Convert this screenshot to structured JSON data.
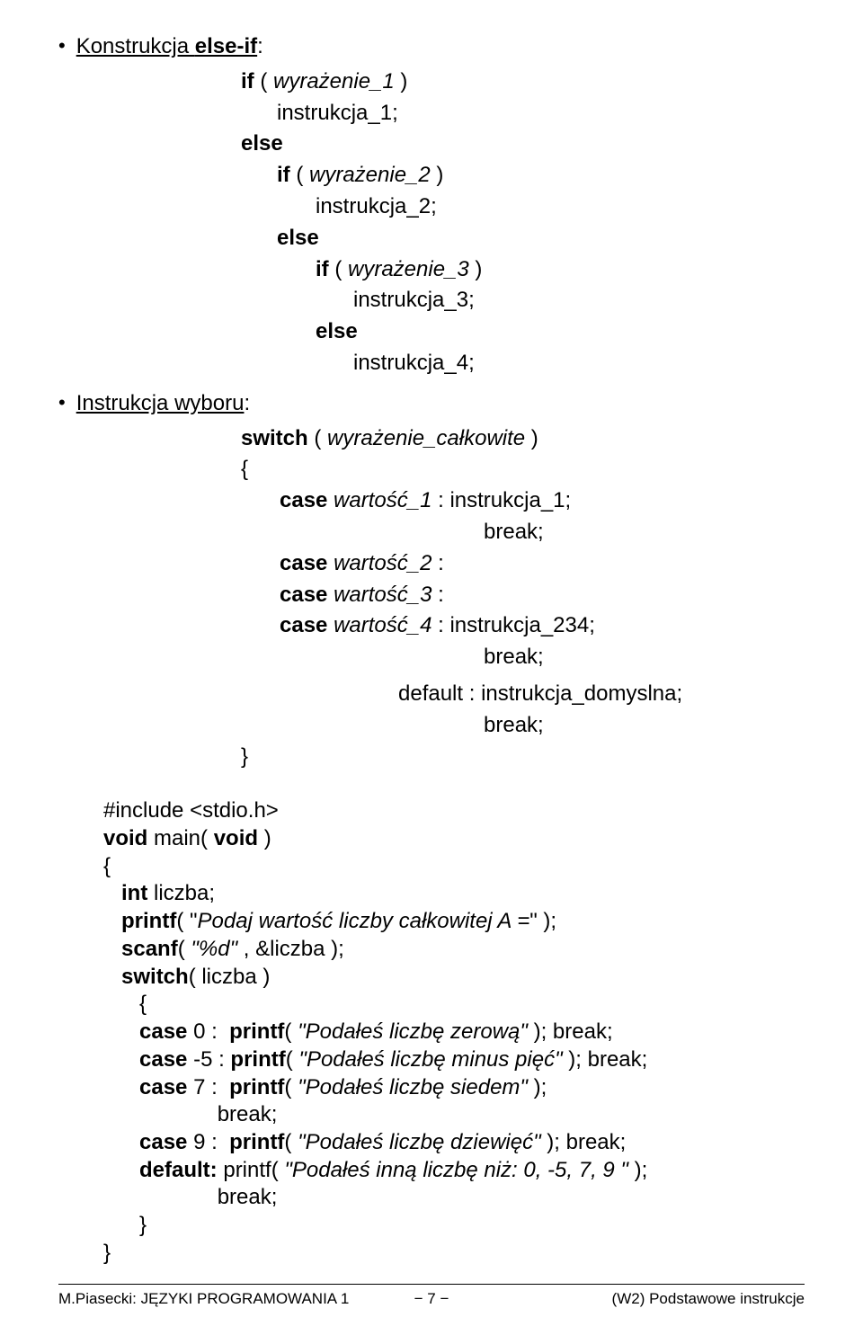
{
  "bullet1": {
    "text_plain": "Konstrukcja  ",
    "text_bold": "else-if",
    "colon": ":"
  },
  "elseif_block": {
    "l1_if": "if",
    "l1_open": " ( ",
    "l1_expr": "wyrażenie_1",
    "l1_close": " )",
    "l2": "instrukcja_1;",
    "l3": "else",
    "l4_if": "if",
    "l4_open": " ( ",
    "l4_expr": "wyrażenie_2",
    "l4_close": " )",
    "l5": "instrukcja_2;",
    "l6": "else",
    "l7_if": "if",
    "l7_open": " ( ",
    "l7_expr": "wyrażenie_3",
    "l7_close": " )",
    "l8": "instrukcja_3;",
    "l9": "else",
    "l10": "instrukcja_4;"
  },
  "bullet2": {
    "text": "Instrukcja wyboru",
    "colon": ":"
  },
  "switch_block": {
    "l1_sw": "switch",
    "l1_open": " ( ",
    "l1_expr": "wyrażenie_całkowite",
    "l1_close": " )",
    "l2": "{",
    "l3_case": "case",
    "l3_v": " wartość_1 ",
    "l3_colon": ":",
    "l3_instr": " instrukcja_1;",
    "l4": "break;",
    "l5_case": "case ",
    "l5_v": "wartość_2 ",
    "l5_colon": ":",
    "l6_case": "case ",
    "l6_v": "wartość_3",
    "l6_after": " :",
    "l7_case": "case ",
    "l7_v": "wartość_4",
    "l7_colon": " :",
    "l7_instr": " instrukcja_234;",
    "l8": "break;",
    "l9_default": "default :  ",
    "l9_instr": "instrukcja_domyslna;",
    "l10": "break;",
    "l11": "}"
  },
  "code": {
    "l1": "#include <stdio.h>",
    "l2a": "void",
    "l2b": " main( ",
    "l2c": "void",
    "l2d": " )",
    "l3": "{",
    "l4a": "   int",
    "l4b": " liczba;",
    "l5a": "   printf",
    "l5b": "( \"",
    "l5c": "Podaj wartość liczby całkowitej A =",
    "l5d": "\" );",
    "l6a": "   scanf",
    "l6b": "( ",
    "l6c": "\"%d\"",
    "l6d": " , &liczba );",
    "l7a": "   switch",
    "l7b": "( liczba )",
    "l8": "      {",
    "l9a": "      case ",
    "l9b": "0 :  ",
    "l9c": "printf",
    "l9d": "( ",
    "l9e": "\"Podałeś liczbę zerową\"",
    "l9f": " ); break;",
    "l10a": "      case ",
    "l10b": "-5 :",
    "l10c": " printf",
    "l10d": "( ",
    "l10e": "\"Podałeś liczbę minus pięć\"",
    "l10f": " ); break;",
    "l11a": "      case ",
    "l11b": "7 :  ",
    "l11c": "printf",
    "l11d": "( ",
    "l11e": "\"Podałeś liczbę siedem\"",
    "l11f": " );",
    "l11g": "                   break;",
    "l12a": "      case ",
    "l12b": "9 :  ",
    "l12c": "printf",
    "l12d": "( ",
    "l12e": "\"Podałeś liczbę dziewięć\"",
    "l12f": " ); break;",
    "l13a": "      default: ",
    "l13b": "printf( ",
    "l13c": "\"Podałeś inną liczbę niż: 0, -5, 7, 9 \"",
    "l13d": " );",
    "l13e": "                   break;",
    "l14": "      }",
    "l15": "}"
  },
  "footer": {
    "left": "M.Piasecki: JĘZYKI PROGRAMOWANIA 1",
    "center": "− 7 −",
    "right": "(W2)  Podstawowe instrukcje"
  }
}
